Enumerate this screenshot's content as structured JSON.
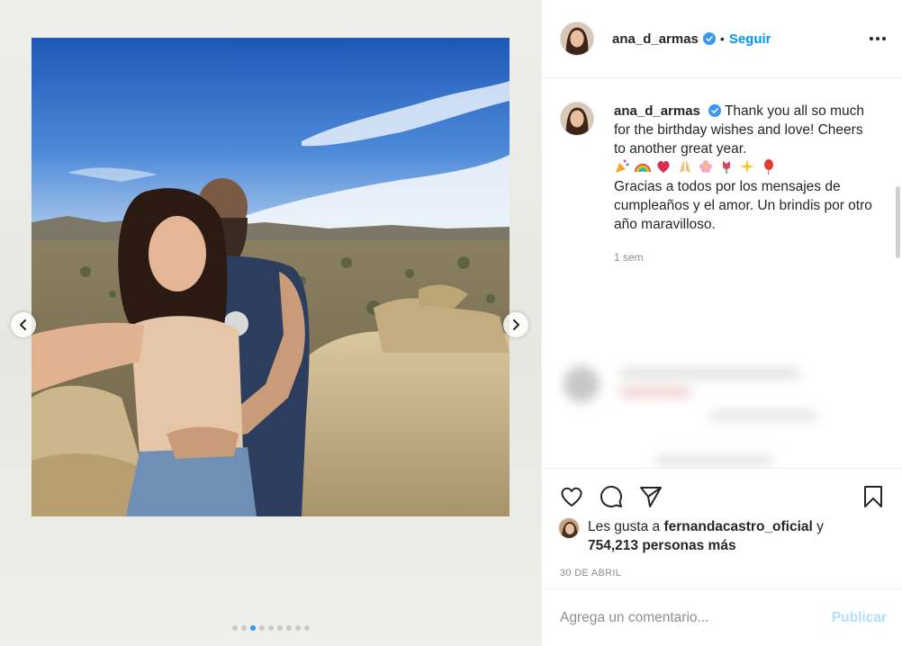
{
  "post": {
    "username": "ana_d_armas",
    "separator": "•",
    "follow_label": "Seguir",
    "caption_line_en": "Thank you all so much for the birthday wishes and love! Cheers to another great year.",
    "caption_emojis": [
      "party-popper",
      "rainbow",
      "heart",
      "praying-hands",
      "blossom",
      "tulip",
      "sparkles",
      "balloon"
    ],
    "caption_line_es": "Gracias a todos por los mensajes de cumpleaños y el amor. Un brindis por otro año maravilloso.",
    "caption_time": "1 sem",
    "likes_prefix": "Les gusta a ",
    "likes_user": "fernandacastro_oficial",
    "likes_and": " y",
    "likes_count": "754,213 personas más",
    "date": "30 DE ABRIL",
    "comment_placeholder": "Agrega un comentario...",
    "post_button": "Publicar"
  },
  "carousel": {
    "total": 9,
    "active_index": 2
  },
  "colors": {
    "accent": "#0095f6",
    "verified": "#3897f0",
    "text": "#262626",
    "muted": "#8e8e8e",
    "post_disabled": "#b2dffc"
  },
  "icons": {
    "like": "heart-icon",
    "comment": "comment-icon",
    "share": "share-icon",
    "save": "bookmark-icon",
    "more": "more-options-icon",
    "prev": "chevron-left-icon",
    "next": "chevron-right-icon"
  }
}
